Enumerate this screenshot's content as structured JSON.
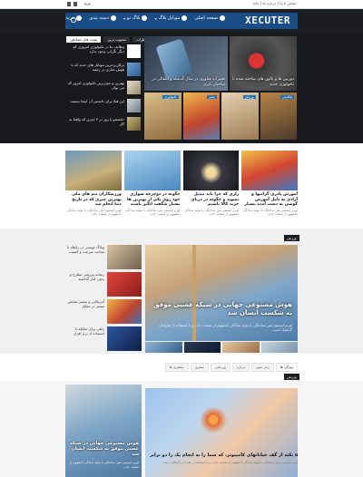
{
  "topbar": {
    "login": "ورود",
    "links": "تماس با ما | درباره ما | خانه"
  },
  "header": {
    "logo": "XECUTER",
    "nav": [
      {
        "label": "صفحه اصلی",
        "icon": "home-icon"
      },
      {
        "label": "موبایل بلاگ",
        "icon": "android-icon"
      },
      {
        "label": "بلاگ نو",
        "icon": "globe-icon"
      },
      {
        "label": "دسته بندی",
        "icon": "grid-icon"
      },
      {
        "label": "خرید",
        "icon": "cart-icon"
      }
    ]
  },
  "hero": {
    "tabs": [
      "پست های تصادفی",
      "محبوب ترین",
      "نظرات"
    ],
    "side_list": [
      {
        "text": "وظایف ما در تکنولوژی امروزی که دیگر نگرانی وجود ندارد"
      },
      {
        "text": "پرکاربردترین موبایل های جدید که با هوش تجاری در زمینه"
      },
      {
        "text": "بهترین و موثرترین تکنولوژی امروز که می توان"
      },
      {
        "text": "این قبلا برای دانستن آن اینجا نیستند"
      },
      {
        "text": "دانشجو یا روز در ۳ چیزی که واقعا به کار"
      }
    ],
    "big_caption": "تغییرات فناوری در سال گذشته و انتقالی در ساختار باتری",
    "med_caption": "دوربین ها و بالون های ساخته شده با تکنولوژی جدید",
    "grid": [
      {
        "badge": "تکنولوژی"
      },
      {
        "badge": "سفر"
      },
      {
        "badge": "ورزش"
      },
      {
        "badge": "عکاسی"
      }
    ]
  },
  "featured": [
    {
      "title": "آموزش پادری گرانبها و آزادی به دلیل آموزش گوشی به دست آمده بسیار",
      "excerpt": "لورم ایپسوم متن ساختگی با تولید سادگی نامفهوم از صنعت چاپ"
    },
    {
      "title": "رازی که چرا باید تبدیل بشوید و چگونه در دریای خرید کالا باشیم",
      "excerpt": "لورم ایپسوم متن ساختگی با تولید سادگی نامفهوم از صنعت چاپ"
    },
    {
      "title": "چگونه در دوچرخه سواری خود روی یکی از بهترین ها بسیار شگفت انگیز باشید",
      "excerpt": "لورم ایپسوم متن ساختگی با تولید سادگی نامفهوم از صنعت چاپ"
    },
    {
      "title": "ورزشکاران تیم های ملی بهترین چیزی که در تاریخ دنیا انجام شد",
      "excerpt": "لورم ایپسوم متن ساختگی با تولید سادگی نامفهوم از صنعت چاپ"
    }
  ],
  "section1": {
    "label": "ورزش",
    "main_title": "هوش مصنوعی جهانی در شبکه عصبی موفق به شکست انسان شد",
    "main_sub": "لورم ایپسوم متن ساختگی با تولید سادگی نامفهوم از صنعت چاپ و با استفاده از طراحان گرافیک است",
    "list": [
      {
        "text": "وبلاگ نویسی در رابطه با ساخت سرعت و کیفیت"
      },
      {
        "text": "رسانه ورزشی مطرح و بدون کنار گذاشته"
      },
      {
        "text": "آمریکایی و بیشتر نمایش بیشتر در مقابل"
      },
      {
        "text": "راهی برای مقابله با استفاده از نرم افزار"
      }
    ]
  },
  "tabs2": [
    "ویژگی ها",
    "رمز عبور",
    "درباره",
    "ورزشی",
    "سفری",
    "بیشتری ها"
  ],
  "section2": {
    "label": "ورزش",
    "left_title": "هوش مصنوعی جهانی در شبکه عصبی موفق به شکست انسان شد",
    "left_ex": "لورم ایپسوم متن ساختگی با تولید سادگی نامفهوم از صنعت چاپ",
    "main_title": "۵ نکته از گف خیابانهای کامپیوتر، که شما را به انجام یک را دو برابر",
    "main_ex": "لورم ایپسوم متن ساختگی با تولید سادگی نامفهوم از صنعت چاپ و با استفاده از طراحان گرافیک است"
  }
}
